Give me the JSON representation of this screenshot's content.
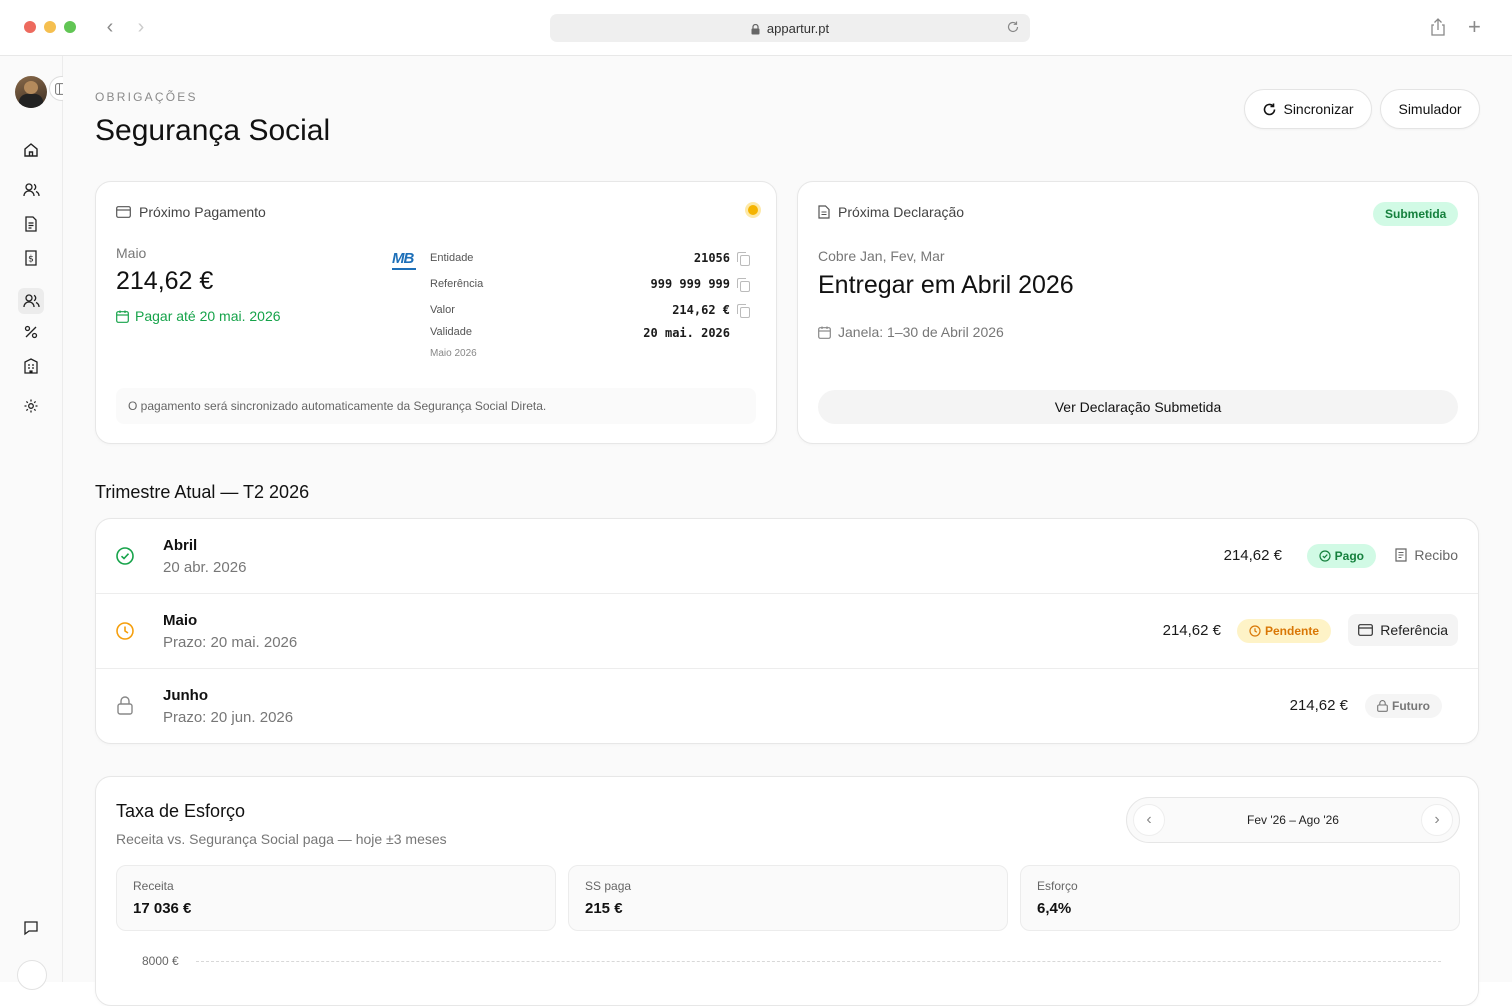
{
  "browser": {
    "url": "appartur.pt"
  },
  "header": {
    "eyebrow": "OBRIGAÇÕES",
    "title": "Segurança Social",
    "sync_label": "Sincronizar",
    "simulator_label": "Simulador"
  },
  "payment": {
    "title": "Próximo Pagamento",
    "month": "Maio",
    "amount": "214,62 €",
    "due": "Pagar até 20 mai. 2026",
    "mb_logo": "MB",
    "fields": [
      {
        "label": "Entidade",
        "value": "21056"
      },
      {
        "label": "Referência",
        "value": "999 999 999"
      },
      {
        "label": "Valor",
        "value": "214,62 €"
      },
      {
        "label": "Validade",
        "value": "20 mai. 2026"
      }
    ],
    "validity_note": "Maio 2026",
    "note": "O pagamento será sincronizado automaticamente da Segurança Social Direta."
  },
  "declaration": {
    "title": "Próxima Declaração",
    "badge": "Submetida",
    "covers": "Cobre Jan, Fev, Mar",
    "deliver": "Entregar em Abril 2026",
    "window": "Janela: 1–30 de Abril 2026",
    "button": "Ver Declaração Submetida"
  },
  "quarter": {
    "title": "Trimestre Atual — T2 2026",
    "rows": [
      {
        "name": "Abril",
        "sub": "20 abr. 2026",
        "amount": "214,62 €",
        "status": "Pago",
        "action": "Recibo"
      },
      {
        "name": "Maio",
        "sub": "Prazo: 20 mai. 2026",
        "amount": "214,62 €",
        "status": "Pendente",
        "action": "Referência"
      },
      {
        "name": "Junho",
        "sub": "Prazo: 20 jun. 2026",
        "amount": "214,62 €",
        "status": "Futuro"
      }
    ]
  },
  "effort": {
    "title": "Taxa de Esforço",
    "subtitle": "Receita vs. Segurança Social paga — hoje ±3 meses",
    "range": "Fev '26 – Ago '26",
    "stats": [
      {
        "label": "Receita",
        "value": "17 036 €"
      },
      {
        "label": "SS paga",
        "value": "215 €"
      },
      {
        "label": "Esforço",
        "value": "6,4%"
      }
    ],
    "axis_first_tick": "8000 €"
  },
  "colors": {
    "green": "#16a34a",
    "green_bg": "#d1fae5",
    "amber": "#f59e0b",
    "amber_bg": "#fef3c7"
  }
}
